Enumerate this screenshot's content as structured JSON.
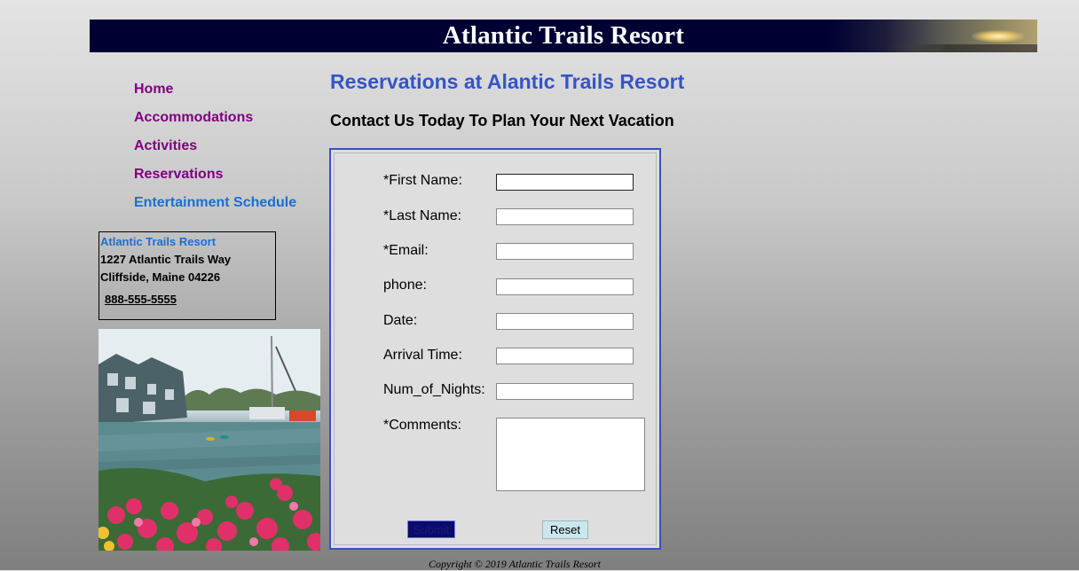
{
  "banner": {
    "title": "Atlantic Trails Resort"
  },
  "nav": {
    "items": [
      {
        "label": "Home",
        "color": "#800080"
      },
      {
        "label": "Accommodations",
        "color": "#800080"
      },
      {
        "label": "Activities",
        "color": "#800080"
      },
      {
        "label": "Reservations",
        "color": "#800080"
      },
      {
        "label": "Entertainment Schedule",
        "color": "#1a6fd0"
      }
    ]
  },
  "address": {
    "name": "Atlantic Trails Resort",
    "line1": "1227 Atlantic Trails Way",
    "line2": "Cliffside, Maine 04226",
    "phone": "888-555-5555"
  },
  "main": {
    "heading": "Reservations at Alantic Trails Resort",
    "subheading": "Contact Us Today To Plan Your Next Vacation"
  },
  "form": {
    "fields": [
      {
        "label": "*First Name:",
        "value": ""
      },
      {
        "label": "*Last Name:",
        "value": ""
      },
      {
        "label": "*Email:",
        "value": ""
      },
      {
        "label": "phone:",
        "value": ""
      },
      {
        "label": "Date:",
        "value": ""
      },
      {
        "label": "Arrival Time:",
        "value": ""
      },
      {
        "label": "Num_of_Nights:",
        "value": ""
      }
    ],
    "comments_label": "*Comments:",
    "comments_value": "",
    "submit_label": "Submit",
    "reset_label": "Reset"
  },
  "footer": {
    "copyright": "Copyright © 2019 Atlantic Trails Resort"
  },
  "colors": {
    "banner_bg": "#000033",
    "heading": "#3455c7",
    "nav_link": "#800080",
    "nav_link_alt": "#1a6fd0",
    "form_border": "#3b4fc8"
  }
}
